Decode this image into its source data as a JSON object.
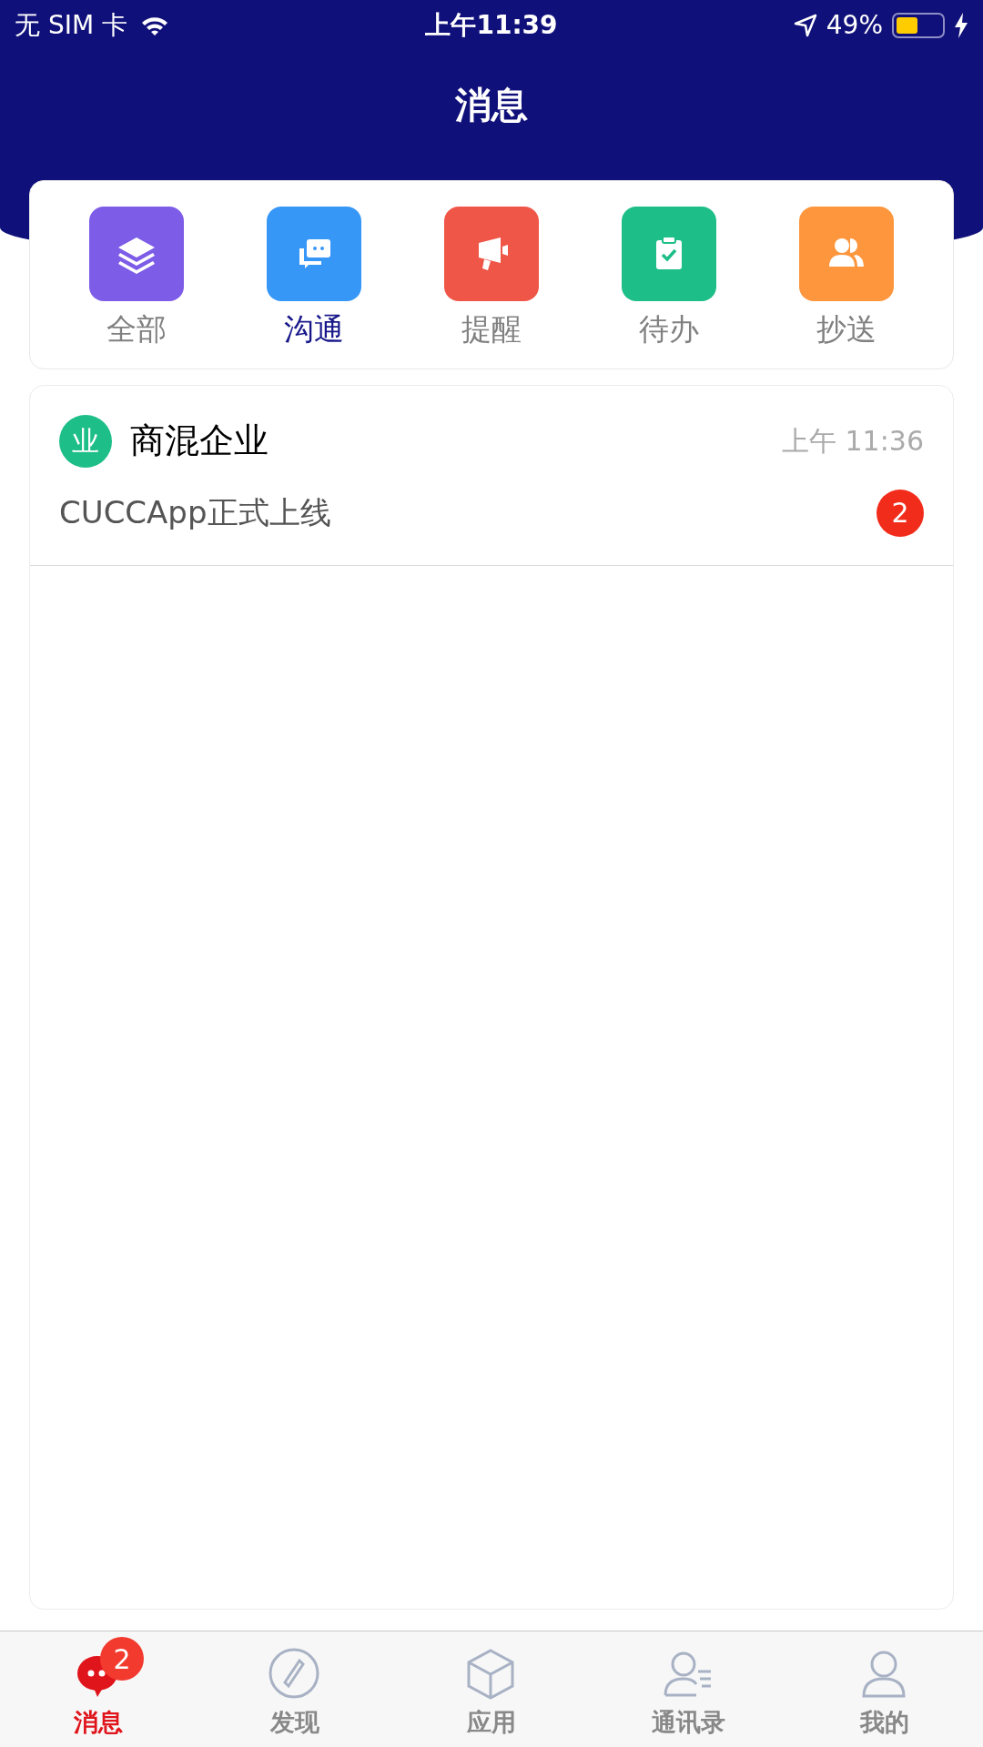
{
  "status_bar": {
    "carrier": "无 SIM 卡",
    "time": "上午11:39",
    "battery": "49%"
  },
  "header": {
    "title": "消息"
  },
  "categories": [
    {
      "label": "全部",
      "kind": "layers",
      "color": "#7d5ce8",
      "selected": false
    },
    {
      "label": "沟通",
      "kind": "chat",
      "color": "#3797f7",
      "selected": true
    },
    {
      "label": "提醒",
      "kind": "horn",
      "color": "#ef5647",
      "selected": false
    },
    {
      "label": "待办",
      "kind": "clipboard",
      "color": "#1dbe87",
      "selected": false
    },
    {
      "label": "抄送",
      "kind": "people",
      "color": "#fd963d",
      "selected": false
    }
  ],
  "messages": [
    {
      "avatar": "业",
      "name": "商混企业",
      "time": "上午 11:36",
      "preview": "CUCCApp正式上线",
      "unread": "2"
    }
  ],
  "bottom_tabs": [
    {
      "label": "消息",
      "kind": "chat",
      "selected": true,
      "badge": "2"
    },
    {
      "label": "发现",
      "kind": "compass",
      "selected": false
    },
    {
      "label": "应用",
      "kind": "box",
      "selected": false
    },
    {
      "label": "通讯录",
      "kind": "contacts",
      "selected": false
    },
    {
      "label": "我的",
      "kind": "person",
      "selected": false
    }
  ]
}
